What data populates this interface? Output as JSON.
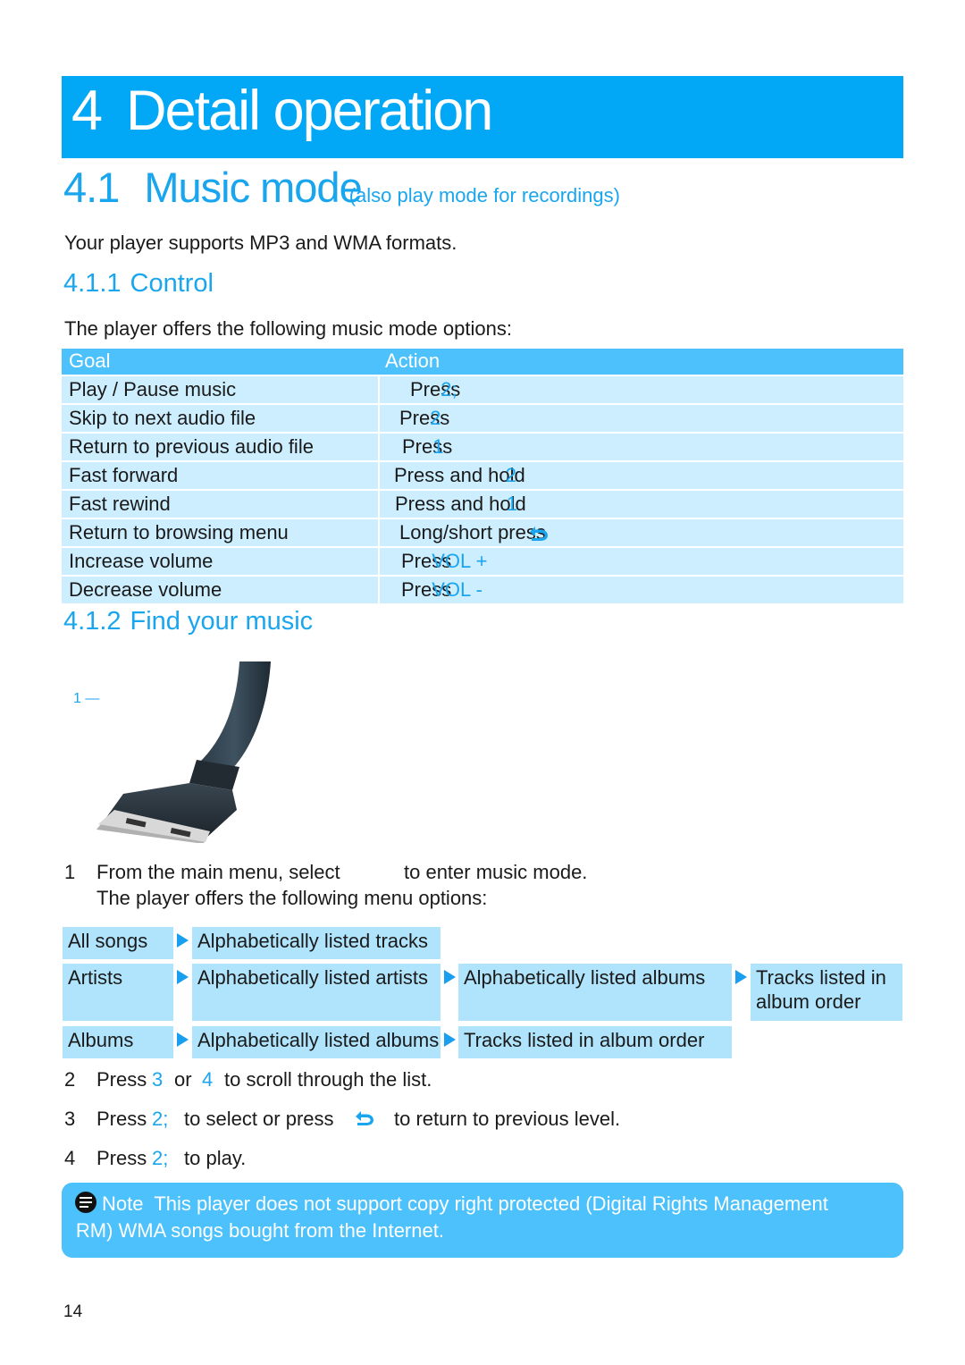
{
  "chapter": {
    "number": "4",
    "title": "Detail operation"
  },
  "section": {
    "number": "4.1",
    "title": "Music mode",
    "subtitle": "(also play mode for recordings)"
  },
  "intro": "Your player supports MP3 and WMA formats.",
  "control": {
    "number": "4.1.1",
    "title": "Control",
    "lead": "The player offers the following music mode options:",
    "headers": {
      "goal": "Goal",
      "action": "Action"
    },
    "rows": [
      {
        "goal": "Play / Pause music",
        "action": "Press",
        "key": "2;"
      },
      {
        "goal": "Skip to next audio file",
        "action": "Press",
        "key": "2"
      },
      {
        "goal": "Return to previous audio file",
        "action": "Press",
        "key": "1"
      },
      {
        "goal": "Fast forward",
        "action": "Press and hold",
        "key": "2"
      },
      {
        "goal": "Fast rewind",
        "action": "Press and hold",
        "key": "1"
      },
      {
        "goal": "Return to browsing menu",
        "action": "Long/short press",
        "key": "back-icon"
      },
      {
        "goal": "Increase volume",
        "action": "Press",
        "key": "VOL +"
      },
      {
        "goal": "Decrease volume",
        "action": "Press",
        "key": "VOL -"
      }
    ]
  },
  "find": {
    "number": "4.1.2",
    "title": "Find your music",
    "image_label": "1",
    "image_icon": "usb-connector-icon",
    "step1_line1_a": "From the main menu, select",
    "step1_line1_b": "to enter music mode.",
    "step1_line2": "The player offers the following menu options:",
    "menu": {
      "all_songs": {
        "label": "All songs",
        "level1": "Alphabetically listed tracks"
      },
      "artists": {
        "label": "Artists",
        "level1": "Alphabetically listed artists",
        "level2": "Alphabetically listed albums",
        "level3": "Tracks listed in album order"
      },
      "albums": {
        "label": "Albums",
        "level1": "Alphabetically listed albums",
        "level2": "Tracks listed in album order"
      }
    },
    "steps": [
      {
        "num": "1"
      },
      {
        "num": "2",
        "a": "Press",
        "k1": "3",
        "b": "or",
        "k2": "4",
        "c": "to scroll through the list."
      },
      {
        "num": "3",
        "a": "Press",
        "k1": "2;",
        "b": "to select or press",
        "c": "to return to previous level."
      },
      {
        "num": "4",
        "a": "Press",
        "k1": "2;",
        "c": "to play."
      }
    ]
  },
  "note": {
    "label": "Note",
    "line1": "This player does not support copy right protected (Digital Rights Management",
    "line2": "DRM) WMA songs bought from the Internet."
  },
  "page_number": "14",
  "colors": {
    "accent": "#02a7f6",
    "header_row": "#4cc1fc",
    "table_row": "#cceeff",
    "menu_box": "#b0e4fc",
    "key_text": "#1aa5ef"
  }
}
